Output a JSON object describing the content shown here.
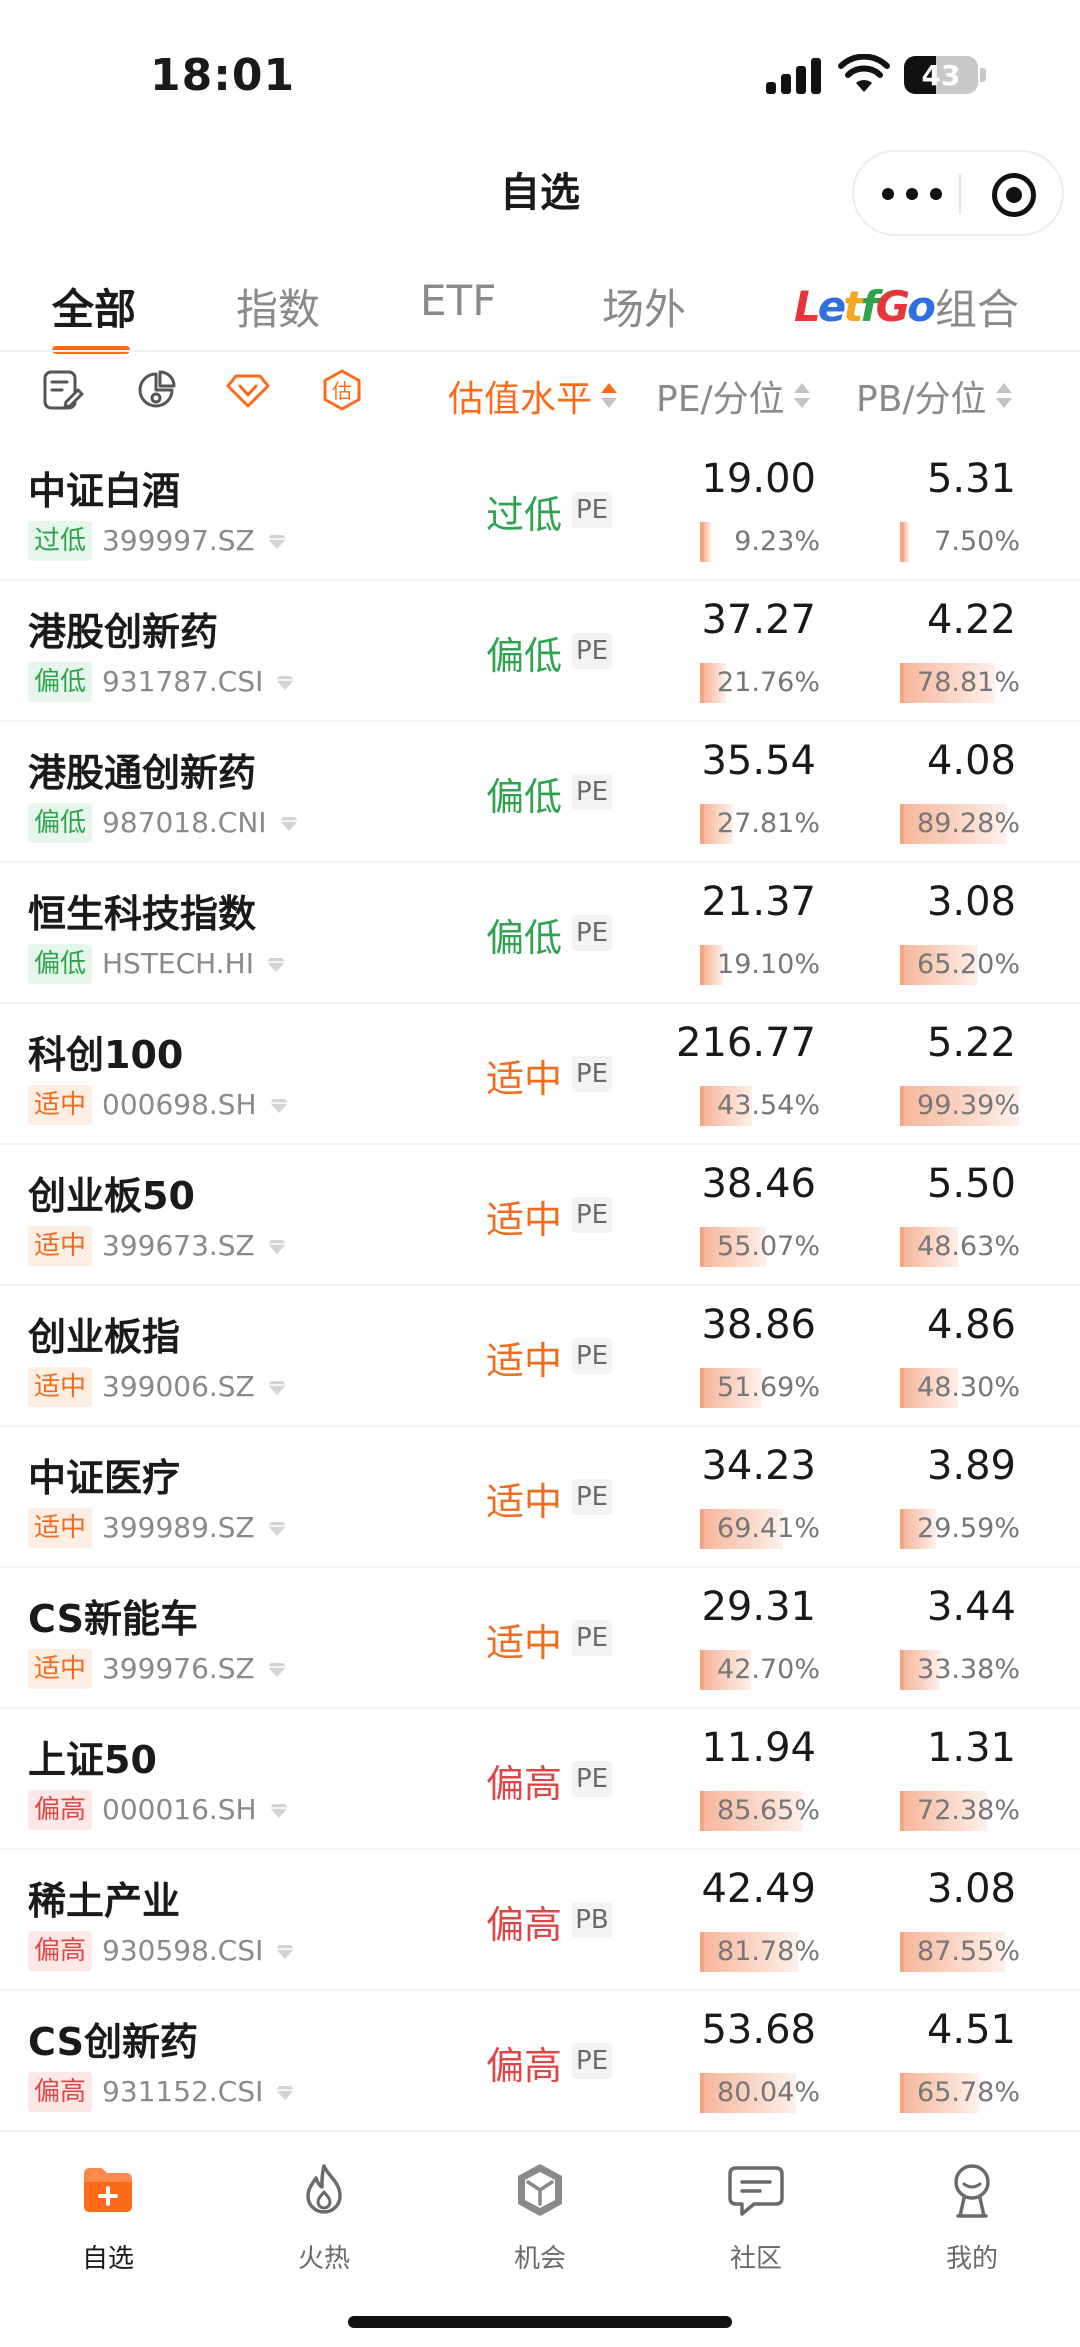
{
  "status_bar": {
    "time": "18:01",
    "battery": "43",
    "battery_level": 0.43
  },
  "nav": {
    "title": "自选"
  },
  "tabs": [
    {
      "label": "全部",
      "active": true
    },
    {
      "label": "指数",
      "active": false
    },
    {
      "label": "ETF",
      "active": false
    },
    {
      "label": "场外",
      "active": false
    }
  ],
  "letsgo": {
    "letters": [
      {
        "ch": "L",
        "color": "#e8343b"
      },
      {
        "ch": "e",
        "color": "#2f6fe0"
      },
      {
        "ch": "t",
        "color": "#f5a623"
      },
      {
        "ch": "f",
        "color": "#2ea44f"
      },
      {
        "ch": "G",
        "color": "#e8343b"
      },
      {
        "ch": "o",
        "color": "#2f6fe0"
      }
    ],
    "label": "组合"
  },
  "filter": {
    "icons": [
      "note-edit-icon",
      "pie-tag-icon",
      "diamond-icon",
      "valuation-hexagon-icon"
    ],
    "valuation_icon_text": "估",
    "sort_headers": {
      "level": "估值水平",
      "pe": "PE/分位",
      "pb": "PB/分位"
    }
  },
  "colors": {
    "accent": "#ff6a1a",
    "low": "#2ea44f",
    "mid": "#f06c1e",
    "high": "#e04646"
  },
  "rows": [
    {
      "name": "中证白酒",
      "badge": "过低",
      "code": "399997.SZ",
      "level": "过低",
      "level_class": "low",
      "metric": "PE",
      "pe": "19.00",
      "pe_pct": "9.23%",
      "pe_pct_val": 9.23,
      "pb": "5.31",
      "pb_pct": "7.50%",
      "pb_pct_val": 7.5
    },
    {
      "name": "港股创新药",
      "badge": "偏低",
      "code": "931787.CSI",
      "level": "偏低",
      "level_class": "low",
      "metric": "PE",
      "pe": "37.27",
      "pe_pct": "21.76%",
      "pe_pct_val": 21.76,
      "pb": "4.22",
      "pb_pct": "78.81%",
      "pb_pct_val": 78.81
    },
    {
      "name": "港股通创新药",
      "badge": "偏低",
      "code": "987018.CNI",
      "level": "偏低",
      "level_class": "low",
      "metric": "PE",
      "pe": "35.54",
      "pe_pct": "27.81%",
      "pe_pct_val": 27.81,
      "pb": "4.08",
      "pb_pct": "89.28%",
      "pb_pct_val": 89.28
    },
    {
      "name": "恒生科技指数",
      "badge": "偏低",
      "code": "HSTECH.HI",
      "level": "偏低",
      "level_class": "low",
      "metric": "PE",
      "pe": "21.37",
      "pe_pct": "19.10%",
      "pe_pct_val": 19.1,
      "pb": "3.08",
      "pb_pct": "65.20%",
      "pb_pct_val": 65.2
    },
    {
      "name": "科创100",
      "badge": "适中",
      "code": "000698.SH",
      "level": "适中",
      "level_class": "mid",
      "metric": "PE",
      "pe": "216.77",
      "pe_pct": "43.54%",
      "pe_pct_val": 43.54,
      "pb": "5.22",
      "pb_pct": "99.39%",
      "pb_pct_val": 99.39
    },
    {
      "name": "创业板50",
      "badge": "适中",
      "code": "399673.SZ",
      "level": "适中",
      "level_class": "mid",
      "metric": "PE",
      "pe": "38.46",
      "pe_pct": "55.07%",
      "pe_pct_val": 55.07,
      "pb": "5.50",
      "pb_pct": "48.63%",
      "pb_pct_val": 48.63
    },
    {
      "name": "创业板指",
      "badge": "适中",
      "code": "399006.SZ",
      "level": "适中",
      "level_class": "mid",
      "metric": "PE",
      "pe": "38.86",
      "pe_pct": "51.69%",
      "pe_pct_val": 51.69,
      "pb": "4.86",
      "pb_pct": "48.30%",
      "pb_pct_val": 48.3
    },
    {
      "name": "中证医疗",
      "badge": "适中",
      "code": "399989.SZ",
      "level": "适中",
      "level_class": "mid",
      "metric": "PE",
      "pe": "34.23",
      "pe_pct": "69.41%",
      "pe_pct_val": 69.41,
      "pb": "3.89",
      "pb_pct": "29.59%",
      "pb_pct_val": 29.59
    },
    {
      "name": "CS新能车",
      "badge": "适中",
      "code": "399976.SZ",
      "level": "适中",
      "level_class": "mid",
      "metric": "PE",
      "pe": "29.31",
      "pe_pct": "42.70%",
      "pe_pct_val": 42.7,
      "pb": "3.44",
      "pb_pct": "33.38%",
      "pb_pct_val": 33.38
    },
    {
      "name": "上证50",
      "badge": "偏高",
      "code": "000016.SH",
      "level": "偏高",
      "level_class": "high",
      "metric": "PE",
      "pe": "11.94",
      "pe_pct": "85.65%",
      "pe_pct_val": 85.65,
      "pb": "1.31",
      "pb_pct": "72.38%",
      "pb_pct_val": 72.38
    },
    {
      "name": "稀土产业",
      "badge": "偏高",
      "code": "930598.CSI",
      "level": "偏高",
      "level_class": "high",
      "metric": "PB",
      "pe": "42.49",
      "pe_pct": "81.78%",
      "pe_pct_val": 81.78,
      "pb": "3.08",
      "pb_pct": "87.55%",
      "pb_pct_val": 87.55
    },
    {
      "name": "CS创新药",
      "badge": "偏高",
      "code": "931152.CSI",
      "level": "偏高",
      "level_class": "high",
      "metric": "PE",
      "pe": "53.68",
      "pe_pct": "80.04%",
      "pe_pct_val": 80.04,
      "pb": "4.51",
      "pb_pct": "65.78%",
      "pb_pct_val": 65.78
    }
  ],
  "tabbar": [
    {
      "label": "自选",
      "icon": "folder-plus-icon",
      "active": true
    },
    {
      "label": "火热",
      "icon": "flame-icon",
      "active": false
    },
    {
      "label": "机会",
      "icon": "cube-icon",
      "active": false
    },
    {
      "label": "社区",
      "icon": "chat-icon",
      "active": false
    },
    {
      "label": "我的",
      "icon": "profile-icon",
      "active": false
    }
  ]
}
